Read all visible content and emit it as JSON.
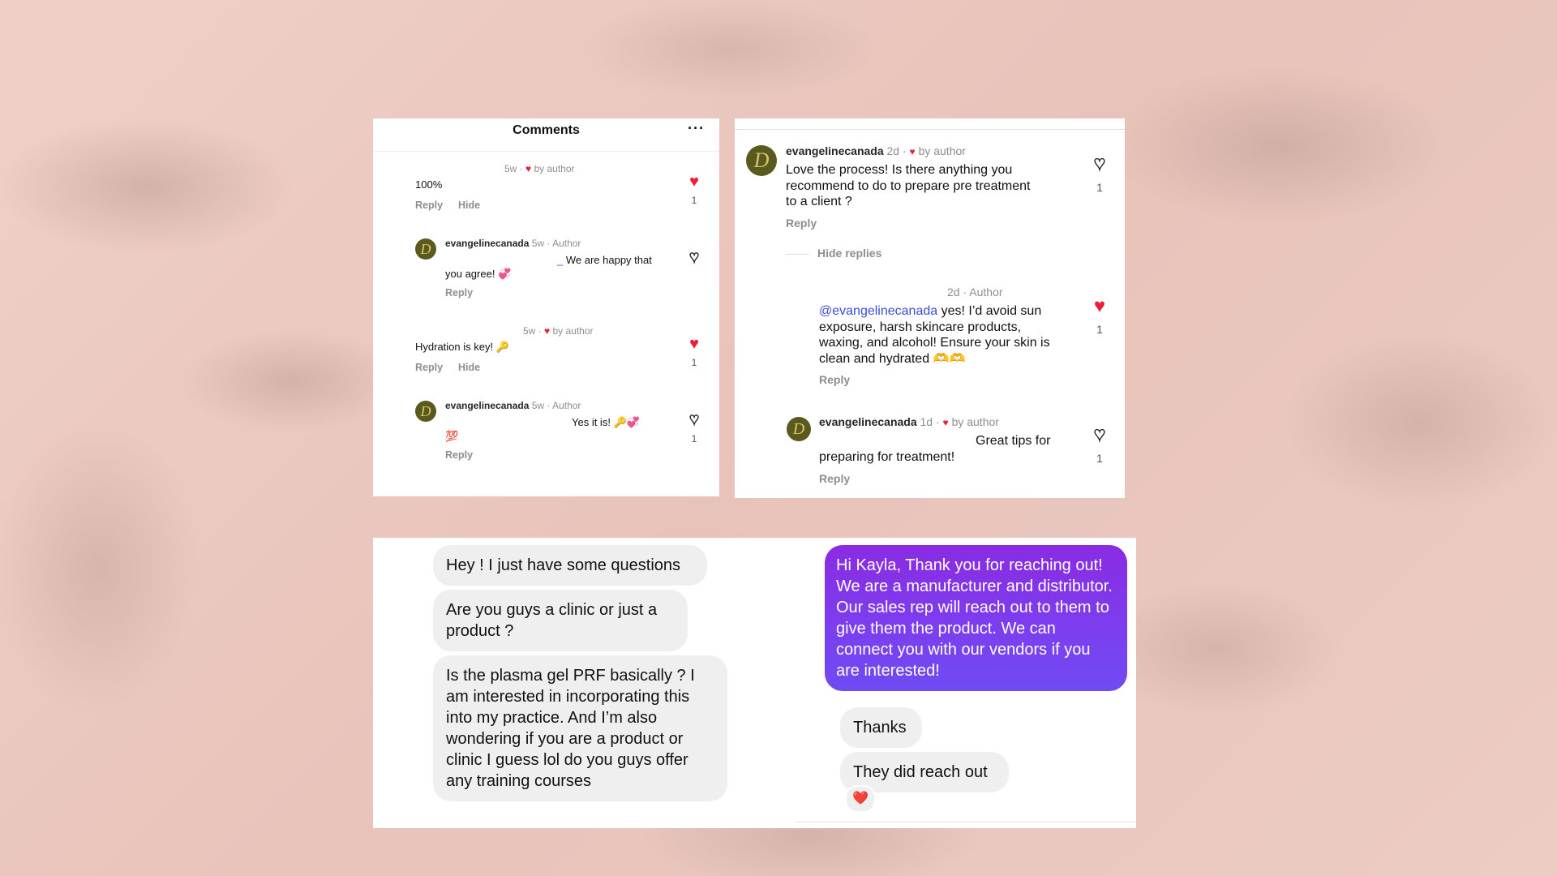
{
  "left": {
    "title": "Comments",
    "more": "···",
    "c1": {
      "meta_time": "5w",
      "meta_by": "by author",
      "text": "100%",
      "reply": "Reply",
      "hide": "Hide",
      "likes": "1"
    },
    "c2": {
      "username": "evangelinecanada",
      "meta": "5w · Author",
      "text_a": "We are happy that",
      "text_b": "you agree! 💞",
      "reply": "Reply"
    },
    "c3": {
      "meta_time": "5w",
      "meta_by": "by author",
      "text": "Hydration is key! 🔑",
      "reply": "Reply",
      "hide": "Hide",
      "likes": "1"
    },
    "c4": {
      "username": "evangelinecanada",
      "meta": "5w · Author",
      "text_a": "Yes it is! 🔑💞",
      "text_b": "💯",
      "reply": "Reply",
      "likes": "1"
    }
  },
  "right": {
    "c1": {
      "username": "evangelinecanada",
      "time": "2d",
      "by": "by author",
      "line1": "Love the process! Is there anything you",
      "line2": "recommend to do to prepare pre  treatment",
      "line3": "to a client ?",
      "reply": "Reply",
      "likes": "1"
    },
    "hide_replies": "Hide replies",
    "c2": {
      "meta": "2d · Author",
      "mention": "@evangelinecanada",
      "line1": " yes! I’d avoid sun",
      "line2": "exposure, harsh skincare products,",
      "line3": "waxing, and alcohol! Ensure your skin is",
      "line4": "clean and hydrated 🫶🫶",
      "reply": "Reply",
      "likes": "1"
    },
    "c3": {
      "username": "evangelinecanada",
      "time": "1d",
      "by": "by author",
      "line1": "Great tips for",
      "line2": "preparing for treatment!",
      "reply": "Reply",
      "likes": "1"
    }
  },
  "dm": {
    "m1": "Hey ! I just have some questions",
    "m2": "Are you guys a clinic or just a product ?",
    "m3": "Is the plasma gel PRF basically ?  I am interested in incorporating this into my practice. And I’m also wondering if you are a product or clinic I guess lol do you guys offer any training courses",
    "m4": "Hi Kayla, Thank you for reaching out! We are a manufacturer and distributor. Our sales rep will reach out to them to give them the product. We can connect you with our vendors if you are interested!",
    "m5": "Thanks",
    "m6": "They did reach out",
    "reaction": "❤️"
  },
  "colors": {
    "heart": "#ed1d3a",
    "mention": "#3b4ed8",
    "sent_bubble": "#7b3ff0"
  }
}
